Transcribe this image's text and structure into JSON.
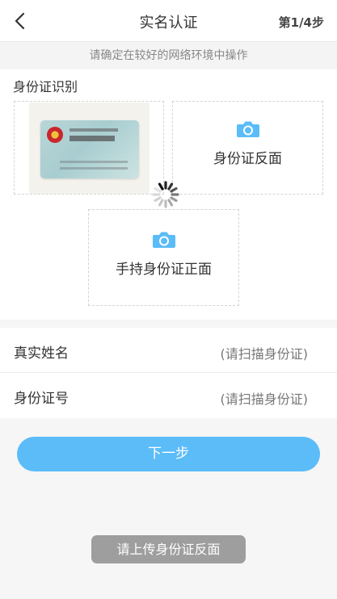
{
  "header": {
    "back_icon": "chevron-left-icon",
    "title": "实名认证",
    "step": "第1/4步"
  },
  "notice": "请确定在较好的网络环境中操作",
  "id_section": {
    "title": "身份证识别",
    "front": {
      "state": "uploaded",
      "image": "id-card-front-photo"
    },
    "back": {
      "icon": "camera-icon",
      "label": "身份证反面"
    },
    "handheld": {
      "icon": "camera-icon",
      "label": "手持身份证正面"
    },
    "loading": true
  },
  "form": {
    "name": {
      "label": "真实姓名",
      "placeholder": "(请扫描身份证)"
    },
    "id_number": {
      "label": "身份证号",
      "placeholder": "(请扫描身份证)"
    }
  },
  "next_button": "下一步",
  "toast": "请上传身份证反面",
  "colors": {
    "accent": "#5bbcf8",
    "camera": "#5bbcf8",
    "toast_bg": "#9e9e9e",
    "page_bg": "#f6f6f6"
  }
}
